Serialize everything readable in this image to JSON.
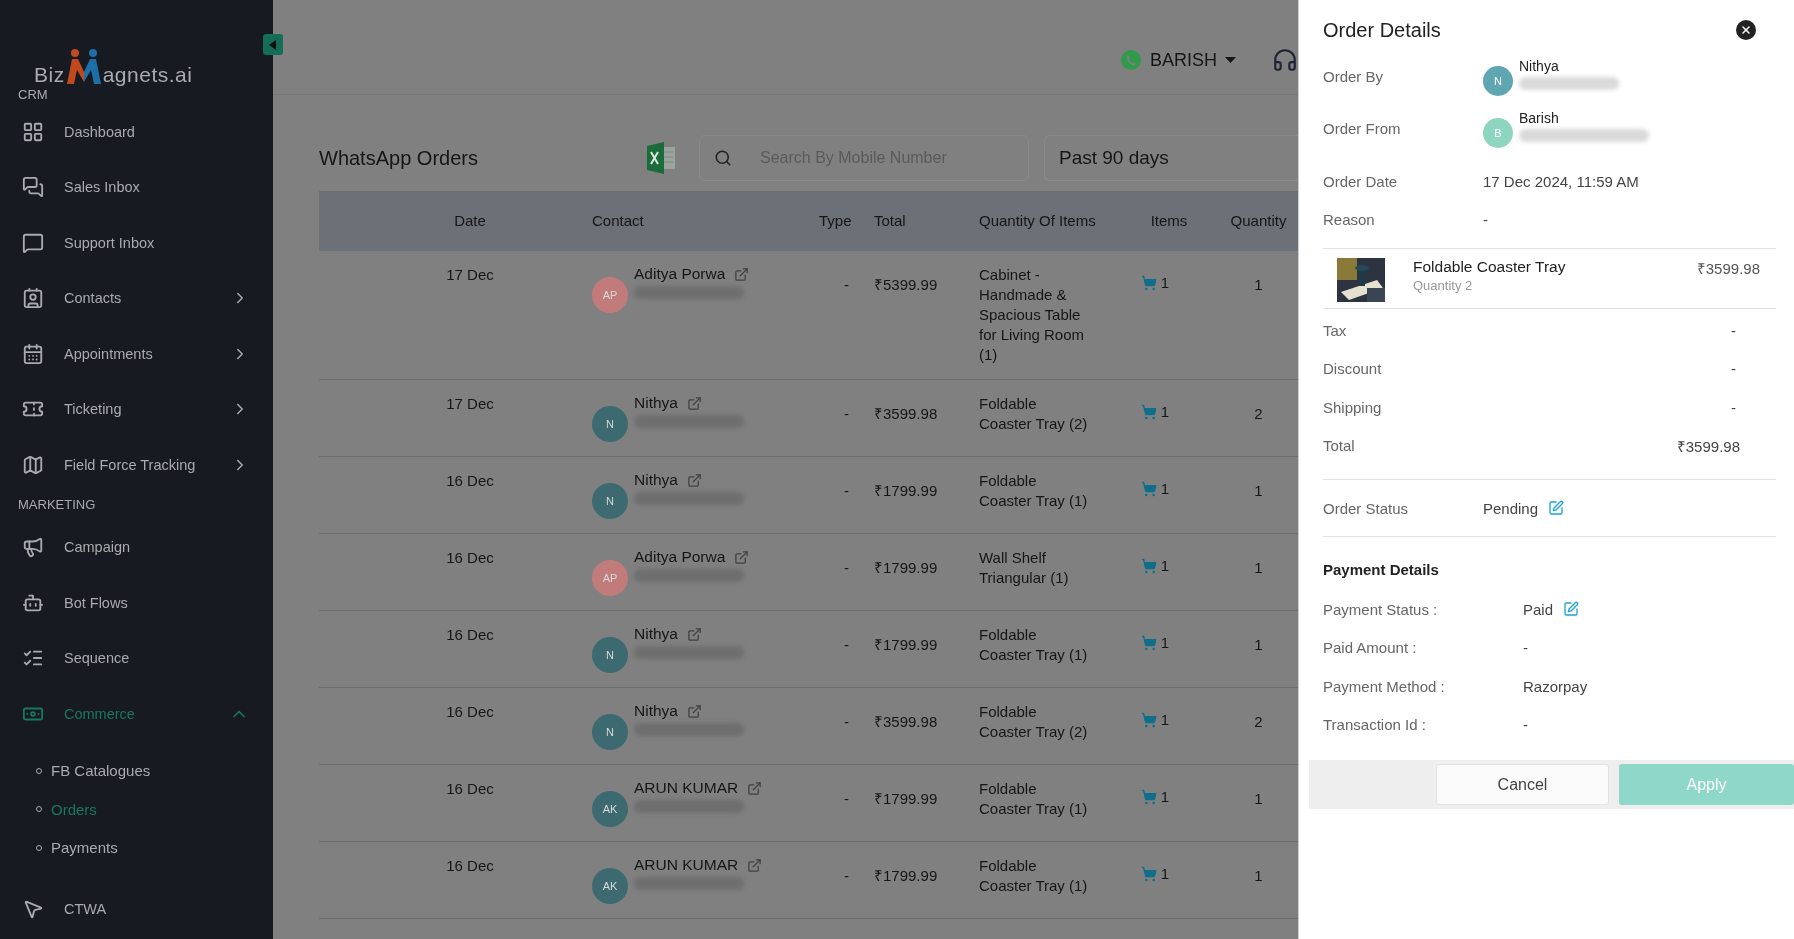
{
  "sidebar": {
    "logo": {
      "left": "Biz",
      "right": "agnets.ai",
      "sub": "CRM"
    },
    "items": [
      {
        "kind": "item",
        "label": "Dashboard"
      },
      {
        "kind": "item",
        "label": "Sales Inbox"
      },
      {
        "kind": "item",
        "label": "Support Inbox"
      },
      {
        "kind": "item",
        "label": "Contacts",
        "expanded": false
      },
      {
        "kind": "item",
        "label": "Appointments",
        "expanded": false
      },
      {
        "kind": "item",
        "label": "Ticketing",
        "expanded": false
      },
      {
        "kind": "item",
        "label": "Field Force Tracking",
        "expanded": false
      },
      {
        "kind": "section",
        "label": "MARKETING"
      },
      {
        "kind": "item",
        "label": "Campaign"
      },
      {
        "kind": "item",
        "label": "Bot Flows"
      },
      {
        "kind": "item",
        "label": "Sequence"
      },
      {
        "kind": "item",
        "label": "Commerce",
        "expanded": true,
        "selected": true,
        "children": [
          {
            "label": "FB Catalogues",
            "selected": false
          },
          {
            "label": "Orders",
            "selected": true
          },
          {
            "label": "Payments",
            "selected": false
          }
        ]
      },
      {
        "kind": "item",
        "label": "CTWA"
      }
    ]
  },
  "header": {
    "account": "BARISH"
  },
  "page": {
    "title": "WhatsApp Orders",
    "search": {
      "placeholder": "Search By Mobile Number"
    },
    "range": "Past 90 days"
  },
  "table": {
    "columns": [
      "Date",
      "Contact",
      "Type",
      "Total",
      "Quantity Of Items",
      "Items",
      "Quantity"
    ],
    "rows": [
      {
        "date": "17 Dec",
        "name": "Aditya Porwa",
        "initials": "AP",
        "color": "#c27b7b",
        "type": "-",
        "total": "₹5399.99",
        "product": "Cabinet - Handmade & Spacious Table for Living Room (1)",
        "items": "1",
        "quantity": "1"
      },
      {
        "date": "17 Dec",
        "name": "Nithya",
        "initials": "N",
        "color": "#3d6a70",
        "type": "-",
        "total": "₹3599.98",
        "product": "Foldable Coaster Tray (2)",
        "items": "1",
        "quantity": "2"
      },
      {
        "date": "16 Dec",
        "name": "Nithya",
        "initials": "N",
        "color": "#3d6a70",
        "type": "-",
        "total": "₹1799.99",
        "product": "Foldable Coaster Tray (1)",
        "items": "1",
        "quantity": "1"
      },
      {
        "date": "16 Dec",
        "name": "Aditya Porwa",
        "initials": "AP",
        "color": "#c27b7b",
        "type": "-",
        "total": "₹1799.99",
        "product": "Wall Shelf Triangular (1)",
        "items": "1",
        "quantity": "1"
      },
      {
        "date": "16 Dec",
        "name": "Nithya",
        "initials": "N",
        "color": "#3d6a70",
        "type": "-",
        "total": "₹1799.99",
        "product": "Foldable Coaster Tray (1)",
        "items": "1",
        "quantity": "1"
      },
      {
        "date": "16 Dec",
        "name": "Nithya",
        "initials": "N",
        "color": "#3d6a70",
        "type": "-",
        "total": "₹3599.98",
        "product": "Foldable Coaster Tray (2)",
        "items": "1",
        "quantity": "2"
      },
      {
        "date": "16 Dec",
        "name": "ARUN KUMAR",
        "initials": "AK",
        "color": "#3d6a70",
        "type": "-",
        "total": "₹1799.99",
        "product": "Foldable Coaster Tray (1)",
        "items": "1",
        "quantity": "1"
      },
      {
        "date": "16 Dec",
        "name": "ARUN KUMAR",
        "initials": "AK",
        "color": "#3d6a70",
        "type": "-",
        "total": "₹1799.99",
        "product": "Foldable Coaster Tray (1)",
        "items": "1",
        "quantity": "1"
      }
    ]
  },
  "drawer": {
    "title": "Order Details",
    "people": [
      {
        "label": "Order By",
        "name": "Nithya",
        "initials": "N",
        "color": "#5ea6b2"
      },
      {
        "label": "Order From",
        "name": "Barish",
        "initials": "B",
        "color": "#8dd5bf"
      }
    ],
    "fields": [
      {
        "label": "Order Date",
        "value": "17 Dec 2024, 11:59 AM"
      },
      {
        "label": "Reason",
        "value": "-"
      }
    ],
    "product": {
      "name": "Foldable Coaster Tray",
      "quantity": "Quantity 2",
      "price": "₹3599.98"
    },
    "summary": [
      {
        "label": "Tax",
        "value": "-"
      },
      {
        "label": "Discount",
        "value": "-"
      },
      {
        "label": "Shipping",
        "value": "-"
      },
      {
        "label": "Total",
        "value": "₹3599.98"
      }
    ],
    "order_status": {
      "label": "Order Status",
      "value": "Pending",
      "editable": true
    },
    "payment_heading": "Payment Details",
    "payment": [
      {
        "label": "Payment Status :",
        "value": "Paid",
        "editable": true
      },
      {
        "label": "Paid Amount :",
        "value": "-",
        "editable": false
      },
      {
        "label": "Payment Method :",
        "value": "Razorpay",
        "editable": false
      },
      {
        "label": "Transaction Id :",
        "value": "-",
        "editable": false
      }
    ],
    "buttons": [
      {
        "kind": "secondary",
        "label": "Cancel"
      },
      {
        "kind": "primary",
        "label": "Apply"
      }
    ]
  }
}
